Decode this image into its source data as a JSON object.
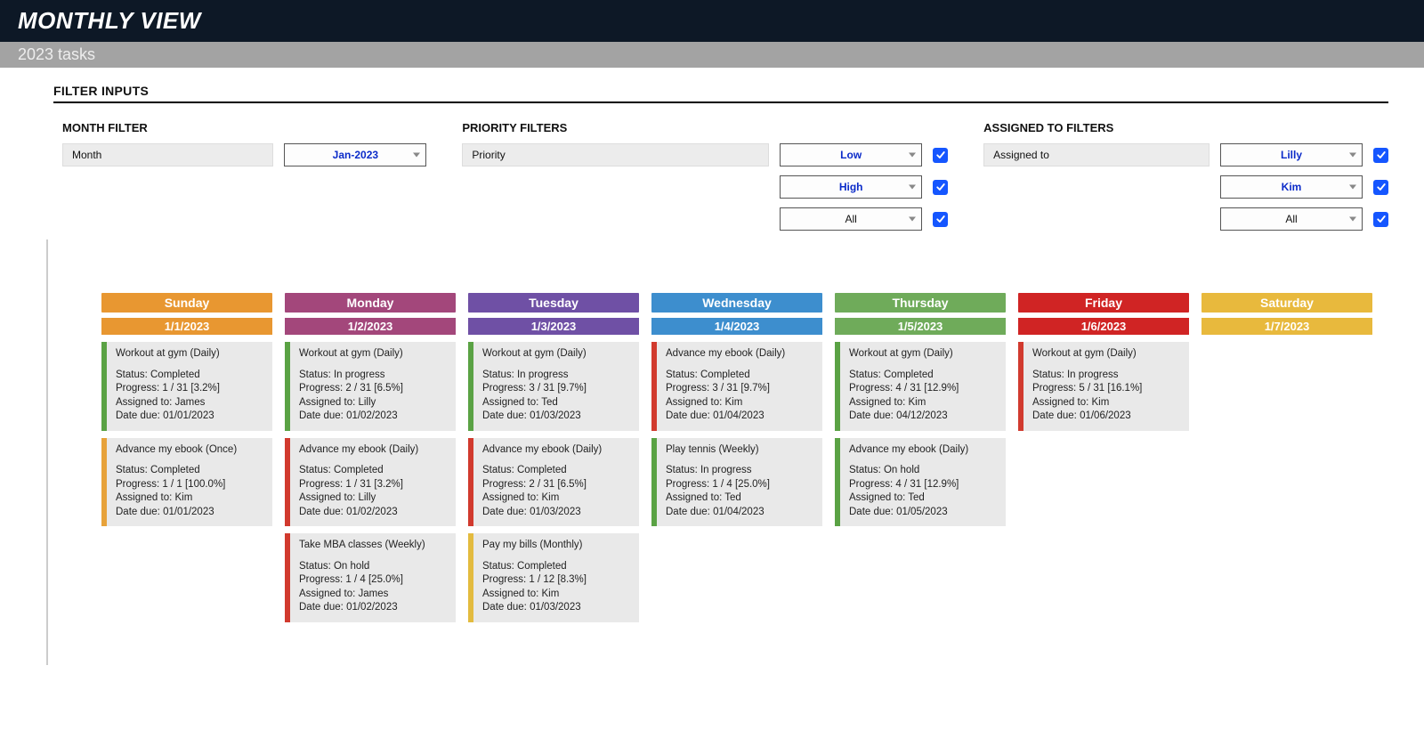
{
  "header": {
    "title": "MONTHLY VIEW",
    "subtitle": "2023 tasks"
  },
  "filterSection": {
    "title": "FILTER INPUTS"
  },
  "monthFilter": {
    "heading": "MONTH FILTER",
    "label": "Month",
    "value": "Jan-2023"
  },
  "priorityFilter": {
    "heading": "PRIORITY FILTERS",
    "label": "Priority",
    "rows": [
      {
        "value": "Low",
        "checked": true,
        "bold": true
      },
      {
        "value": "High",
        "checked": true,
        "bold": true
      },
      {
        "value": "All",
        "checked": true,
        "bold": false
      }
    ]
  },
  "assignedFilter": {
    "heading": "ASSIGNED TO FILTERS",
    "label": "Assigned to",
    "rows": [
      {
        "value": "Lilly",
        "checked": true,
        "bold": true
      },
      {
        "value": "Kim",
        "checked": true,
        "bold": true
      },
      {
        "value": "All",
        "checked": true,
        "bold": false
      }
    ]
  },
  "days": [
    {
      "name": "Sunday",
      "date": "1/1/2023",
      "colorClass": "c-sun",
      "tasks": [
        {
          "title": "Workout at gym (Daily)",
          "status": "Completed",
          "progress": "1 / 31  [3.2%]",
          "assigned": "James",
          "due": "01/01/2023",
          "stripe": "s-green"
        },
        {
          "title": "Advance my ebook (Once)",
          "status": "Completed",
          "progress": "1 / 1  [100.0%]",
          "assigned": "Kim",
          "due": "01/01/2023",
          "stripe": "s-orange"
        }
      ]
    },
    {
      "name": "Monday",
      "date": "1/2/2023",
      "colorClass": "c-mon",
      "tasks": [
        {
          "title": "Workout at gym (Daily)",
          "status": "In progress",
          "progress": "2 / 31  [6.5%]",
          "assigned": "Lilly",
          "due": "01/02/2023",
          "stripe": "s-green"
        },
        {
          "title": "Advance my ebook (Daily)",
          "status": "Completed",
          "progress": "1 / 31  [3.2%]",
          "assigned": "Lilly",
          "due": "01/02/2023",
          "stripe": "s-red"
        },
        {
          "title": "Take MBA classes (Weekly)",
          "status": "On hold",
          "progress": "1 / 4  [25.0%]",
          "assigned": "James",
          "due": "01/02/2023",
          "stripe": "s-red"
        }
      ]
    },
    {
      "name": "Tuesday",
      "date": "1/3/2023",
      "colorClass": "c-tue",
      "tasks": [
        {
          "title": "Workout at gym (Daily)",
          "status": "In progress",
          "progress": "3 / 31  [9.7%]",
          "assigned": "Ted",
          "due": "01/03/2023",
          "stripe": "s-green"
        },
        {
          "title": "Advance my ebook (Daily)",
          "status": "Completed",
          "progress": "2 / 31  [6.5%]",
          "assigned": "Kim",
          "due": "01/03/2023",
          "stripe": "s-red"
        },
        {
          "title": "Pay my bills (Monthly)",
          "status": "Completed",
          "progress": "1 / 12  [8.3%]",
          "assigned": "Kim",
          "due": "01/03/2023",
          "stripe": "s-yellow"
        }
      ]
    },
    {
      "name": "Wednesday",
      "date": "1/4/2023",
      "colorClass": "c-wed",
      "tasks": [
        {
          "title": "Advance my ebook (Daily)",
          "status": "Completed",
          "progress": "3 / 31  [9.7%]",
          "assigned": "Kim",
          "due": "01/04/2023",
          "stripe": "s-red"
        },
        {
          "title": "Play tennis (Weekly)",
          "status": "In progress",
          "progress": "1 / 4  [25.0%]",
          "assigned": "Ted",
          "due": "01/04/2023",
          "stripe": "s-green"
        }
      ]
    },
    {
      "name": "Thursday",
      "date": "1/5/2023",
      "colorClass": "c-thu",
      "tasks": [
        {
          "title": "Workout at gym (Daily)",
          "status": "Completed",
          "progress": "4 / 31  [12.9%]",
          "assigned": "Kim",
          "due": "04/12/2023",
          "stripe": "s-green"
        },
        {
          "title": "Advance my ebook (Daily)",
          "status": "On hold",
          "progress": "4 / 31  [12.9%]",
          "assigned": "Ted",
          "due": "01/05/2023",
          "stripe": "s-green"
        }
      ]
    },
    {
      "name": "Friday",
      "date": "1/6/2023",
      "colorClass": "c-fri",
      "tasks": [
        {
          "title": "Workout at gym (Daily)",
          "status": "In progress",
          "progress": "5 / 31  [16.1%]",
          "assigned": "Kim",
          "due": "01/06/2023",
          "stripe": "s-red"
        }
      ]
    },
    {
      "name": "Saturday",
      "date": "1/7/2023",
      "colorClass": "c-sat",
      "tasks": []
    }
  ],
  "labels": {
    "status": "Status:",
    "progress": "Progress:",
    "assigned": "Assigned to:",
    "due": "Date due:"
  }
}
